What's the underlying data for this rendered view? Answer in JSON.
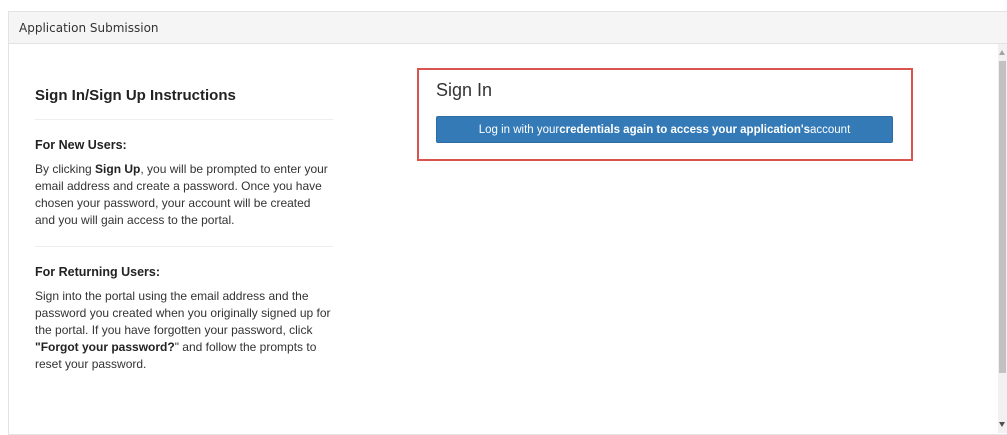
{
  "panel": {
    "title": "Application Submission"
  },
  "instructions": {
    "title": "Sign In/Sign Up Instructions",
    "new_users": {
      "heading": "For New Users:",
      "text_1": "By clicking ",
      "bold_1": "Sign Up",
      "text_2": ", you will be prompted to enter your email address and create a password. Once you have chosen your password, your account will be created and you will gain access to the portal."
    },
    "returning_users": {
      "heading": "For Returning Users:",
      "text_1": "Sign into the portal using the email address and the password you created when you originally signed up for the portal. If you have forgotten your password, click ",
      "bold_1": "\"Forgot your password?",
      "text_2": "\" and follow the prompts to reset your password."
    }
  },
  "signin": {
    "title": "Sign In",
    "button": {
      "prefix": "Log in with your ",
      "bold": "credentials again to access your application's",
      "suffix": " account"
    }
  },
  "colors": {
    "button_bg": "#337ab7",
    "highlight_border": "#d9534f",
    "header_bg": "#f5f5f5"
  }
}
